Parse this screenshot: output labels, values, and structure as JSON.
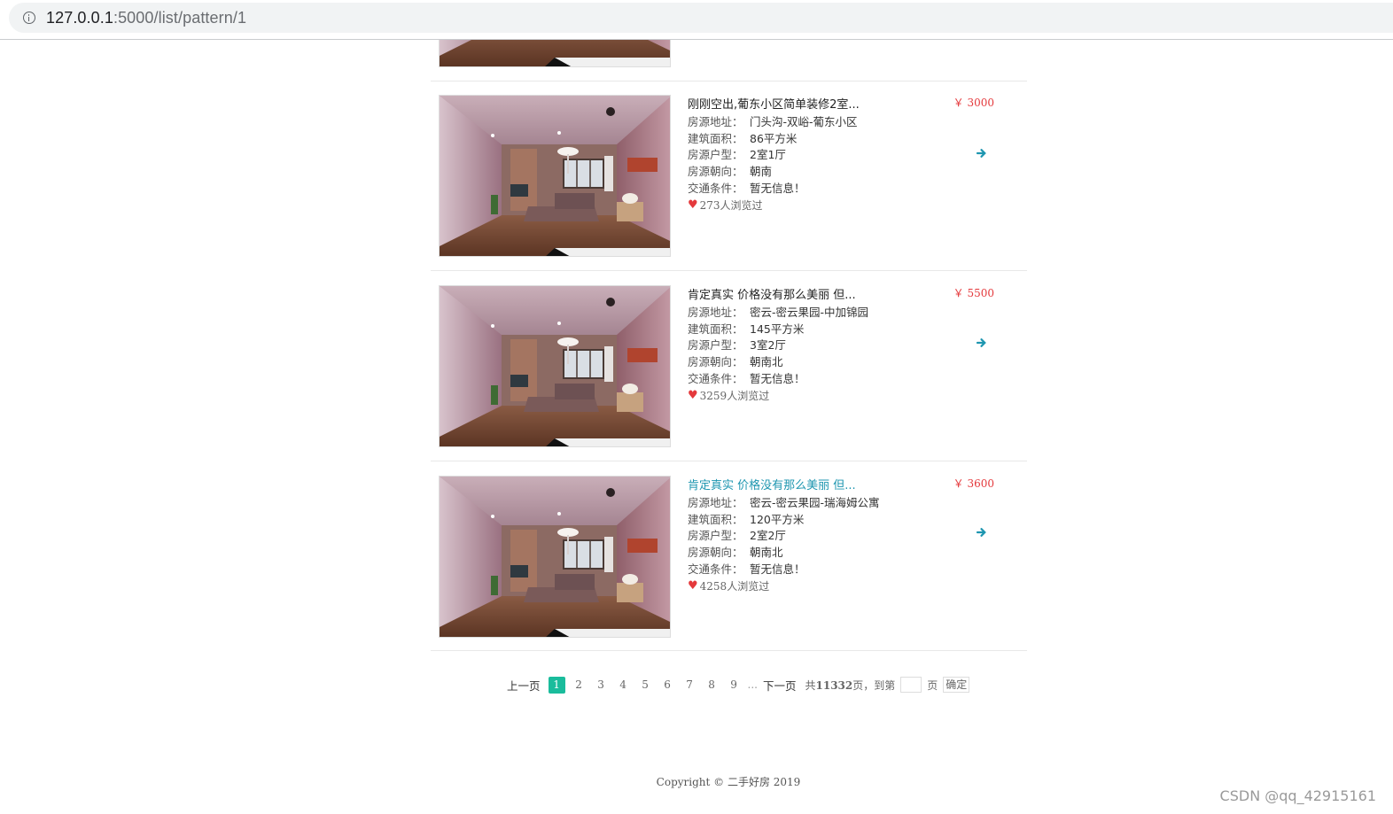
{
  "browser": {
    "url_host": "127.0.0.1",
    "url_rest": ":5000/list/pattern/1"
  },
  "listings": [
    {
      "title": "刚刚空出,葡东小区简单装修2室...",
      "price": "￥ 3000",
      "address_label": "房源地址：",
      "address": "门头沟-双峪-葡东小区",
      "area_label": "建筑面积：",
      "area": "86平方米",
      "layout_label": "房源户型：",
      "layout": "2室1厅",
      "orientation_label": "房源朝向：",
      "orientation": "朝南",
      "traffic_label": "交通条件：",
      "traffic": "暂无信息！",
      "views": "273人浏览过",
      "highlighted": false
    },
    {
      "title": "肯定真实 价格没有那么美丽 但...",
      "price": "￥ 5500",
      "address_label": "房源地址：",
      "address": "密云-密云果园-中加锦园",
      "area_label": "建筑面积：",
      "area": "145平方米",
      "layout_label": "房源户型：",
      "layout": "3室2厅",
      "orientation_label": "房源朝向：",
      "orientation": "朝南北",
      "traffic_label": "交通条件：",
      "traffic": "暂无信息！",
      "views": "3259人浏览过",
      "highlighted": false
    },
    {
      "title": "肯定真实 价格没有那么美丽 但...",
      "price": "￥ 3600",
      "address_label": "房源地址：",
      "address": "密云-密云果园-瑞海姆公寓",
      "area_label": "建筑面积：",
      "area": "120平方米",
      "layout_label": "房源户型：",
      "layout": "2室2厅",
      "orientation_label": "房源朝向：",
      "orientation": "朝南北",
      "traffic_label": "交通条件：",
      "traffic": "暂无信息！",
      "views": "4258人浏览过",
      "highlighted": true
    }
  ],
  "pagination": {
    "prev_label": "上一页",
    "pages": [
      "1",
      "2",
      "3",
      "4",
      "5",
      "6",
      "7",
      "8",
      "9"
    ],
    "active_page": "1",
    "ellipsis": "...",
    "next_label": "下一页",
    "total_prefix": "共",
    "total_pages": "11332",
    "total_suffix": "页，到第",
    "page_unit": "页",
    "confirm_label": "确定"
  },
  "footer": {
    "copyright": "Copyright © 二手好房 2019"
  },
  "watermark": "CSDN @qq_42915161",
  "colors": {
    "price": "#e4393c",
    "accent": "#1abc9c",
    "highlight_title": "#1e96b0",
    "arrow": "#1e96b0"
  }
}
